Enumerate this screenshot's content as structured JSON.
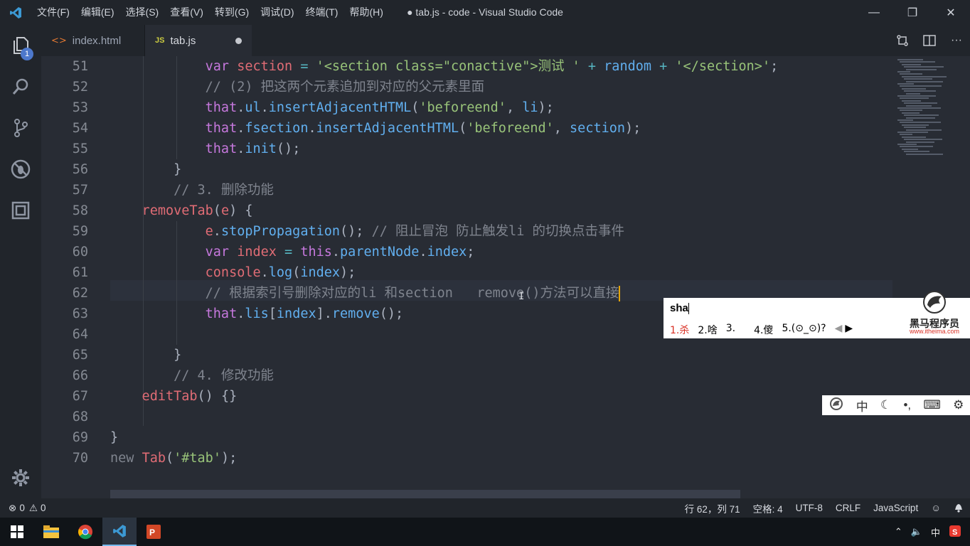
{
  "window": {
    "title": "● tab.js - code - Visual Studio Code",
    "menu": [
      "文件(F)",
      "编辑(E)",
      "选择(S)",
      "查看(V)",
      "转到(G)",
      "调试(D)",
      "终端(T)",
      "帮助(H)"
    ]
  },
  "activity": {
    "explorer_badge": "1",
    "icons": [
      "files-icon",
      "search-icon",
      "source-control-icon",
      "debug-icon",
      "extensions-icon"
    ]
  },
  "tabs": [
    {
      "label": "index.html",
      "icon": "html-icon",
      "active": false
    },
    {
      "label": "tab.js",
      "icon": "js-icon",
      "active": true,
      "dirty": true
    }
  ],
  "editor": {
    "line_numbers": [
      "51",
      "52",
      "53",
      "54",
      "55",
      "56",
      "57",
      "58",
      "59",
      "60",
      "61",
      "62",
      "63",
      "64",
      "65",
      "66",
      "67",
      "68",
      "69",
      "70"
    ],
    "lines": [
      [
        [
          "kw",
          "            var "
        ],
        [
          "var",
          "section"
        ],
        [
          "op",
          " = "
        ],
        [
          "str",
          "'<section class=\"conactive\">测试 '"
        ],
        [
          "op",
          " + "
        ],
        [
          "fn",
          "random"
        ],
        [
          "op",
          " + "
        ],
        [
          "str",
          "'</section>'"
        ],
        [
          "punc",
          ";"
        ]
      ],
      [
        [
          "cm",
          "            // (2) 把这两个元素追加到对应的父元素里面"
        ]
      ],
      [
        [
          "kw",
          "            that"
        ],
        [
          "punc",
          "."
        ],
        [
          "fn",
          "ul"
        ],
        [
          "punc",
          "."
        ],
        [
          "fn",
          "insertAdjacentHTML"
        ],
        [
          "punc",
          "("
        ],
        [
          "str",
          "'beforeend'"
        ],
        [
          "punc",
          ", "
        ],
        [
          "fn",
          "li"
        ],
        [
          "punc",
          ");"
        ]
      ],
      [
        [
          "kw",
          "            that"
        ],
        [
          "punc",
          "."
        ],
        [
          "fn",
          "fsection"
        ],
        [
          "punc",
          "."
        ],
        [
          "fn",
          "insertAdjacentHTML"
        ],
        [
          "punc",
          "("
        ],
        [
          "str",
          "'beforeend'"
        ],
        [
          "punc",
          ", "
        ],
        [
          "fn",
          "section"
        ],
        [
          "punc",
          ");"
        ]
      ],
      [
        [
          "kw",
          "            that"
        ],
        [
          "punc",
          "."
        ],
        [
          "fn",
          "init"
        ],
        [
          "punc",
          "();"
        ]
      ],
      [
        [
          "punc",
          "        }"
        ]
      ],
      [
        [
          "cm",
          "        // 3. 删除功能"
        ]
      ],
      [
        [
          "prop",
          "    removeTab"
        ],
        [
          "punc",
          "("
        ],
        [
          "var",
          "e"
        ],
        [
          "punc",
          ") {"
        ]
      ],
      [
        [
          "var",
          "            e"
        ],
        [
          "punc",
          "."
        ],
        [
          "fn",
          "stopPropagation"
        ],
        [
          "punc",
          "(); "
        ],
        [
          "cm",
          "// 阻止冒泡 防止触发li 的切换点击事件"
        ]
      ],
      [
        [
          "kw",
          "            var "
        ],
        [
          "var",
          "index"
        ],
        [
          "op",
          " = "
        ],
        [
          "kw",
          "this"
        ],
        [
          "punc",
          "."
        ],
        [
          "fn",
          "parentNode"
        ],
        [
          "punc",
          "."
        ],
        [
          "fn",
          "index"
        ],
        [
          "punc",
          ";"
        ]
      ],
      [
        [
          "prop",
          "            console"
        ],
        [
          "punc",
          "."
        ],
        [
          "fn",
          "log"
        ],
        [
          "punc",
          "("
        ],
        [
          "fn",
          "index"
        ],
        [
          "punc",
          ");"
        ]
      ],
      [
        [
          "cm",
          "            // 根据索引号删除对应的li 和section   remove()方法可以直接"
        ]
      ],
      [
        [
          "kw",
          "            that"
        ],
        [
          "punc",
          "."
        ],
        [
          "fn",
          "lis"
        ],
        [
          "punc",
          "["
        ],
        [
          "fn",
          "index"
        ],
        [
          "punc",
          "]."
        ],
        [
          "fn",
          "remove"
        ],
        [
          "punc",
          "();"
        ]
      ],
      [
        [
          "punc",
          ""
        ]
      ],
      [
        [
          "punc",
          "        }"
        ]
      ],
      [
        [
          "cm",
          "        // 4. 修改功能"
        ]
      ],
      [
        [
          "prop",
          "    editTab"
        ],
        [
          "punc",
          "() {}"
        ]
      ],
      [
        [
          "punc",
          ""
        ]
      ],
      [
        [
          "punc",
          "}"
        ]
      ],
      [
        [
          "cm",
          "new "
        ],
        [
          "var",
          "Tab"
        ],
        [
          "punc",
          "("
        ],
        [
          "str",
          "'#tab'"
        ],
        [
          "punc",
          ");"
        ]
      ]
    ]
  },
  "ime": {
    "input": "sha",
    "candidates": [
      "1.杀",
      "2.啥",
      "3.",
      "4.傻",
      "5.(⊙_⊙)?"
    ],
    "brand_cn": "黑马程序员",
    "brand_url": "www.itheima.com",
    "toolbar": [
      "中"
    ]
  },
  "status": {
    "errors": "0",
    "warnings": "0",
    "position": "行 62，列 71",
    "spaces": "空格: 4",
    "encoding": "UTF-8",
    "eol": "CRLF",
    "language": "JavaScript"
  },
  "tray": {
    "ime_mode": "中"
  },
  "colors": {
    "editor_bg": "#282c34",
    "chrome_bg": "#21252b",
    "accent": "#4d78cc"
  }
}
